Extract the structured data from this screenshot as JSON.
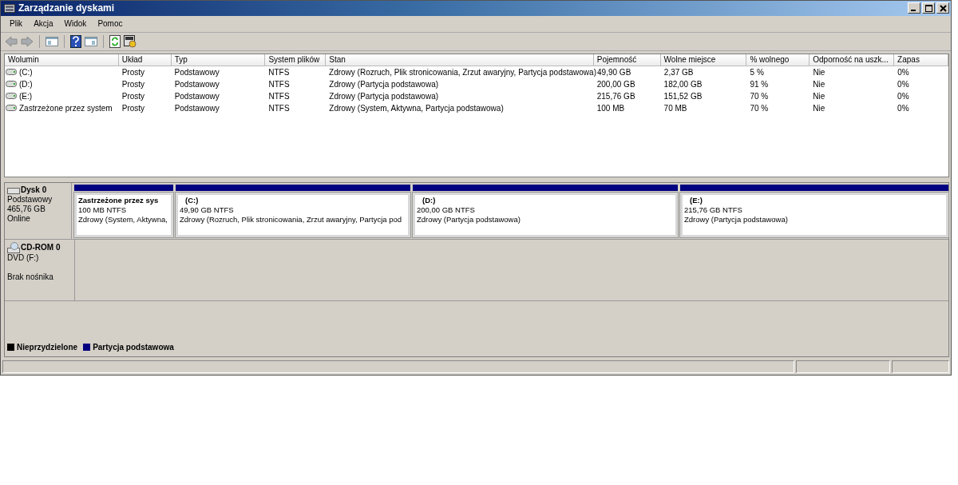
{
  "window": {
    "title": "Zarządzanie dyskami"
  },
  "menu": [
    "Plik",
    "Akcja",
    "Widok",
    "Pomoc"
  ],
  "volumes": {
    "columns": [
      "Wolumin",
      "Układ",
      "Typ",
      "System plików",
      "Stan",
      "Pojemność",
      "Wolne miejsce",
      "% wolnego",
      "Odporność na uszk...",
      "Zapas"
    ],
    "rows": [
      [
        "(C:)",
        "Prosty",
        "Podstawowy",
        "NTFS",
        "Zdrowy (Rozruch, Plik stronicowania, Zrzut awaryjny, Partycja podstawowa)",
        "49,90 GB",
        "2,37 GB",
        "5 %",
        "Nie",
        "0%"
      ],
      [
        "(D:)",
        "Prosty",
        "Podstawowy",
        "NTFS",
        "Zdrowy (Partycja podstawowa)",
        "200,00 GB",
        "182,00 GB",
        "91 %",
        "Nie",
        "0%"
      ],
      [
        "(E:)",
        "Prosty",
        "Podstawowy",
        "NTFS",
        "Zdrowy (Partycja podstawowa)",
        "215,76 GB",
        "151,52 GB",
        "70 %",
        "Nie",
        "0%"
      ],
      [
        "Zastrzeżone przez system",
        "Prosty",
        "Podstawowy",
        "NTFS",
        "Zdrowy (System, Aktywna, Partycja podstawowa)",
        "100 MB",
        "70 MB",
        "70 %",
        "Nie",
        "0%"
      ]
    ]
  },
  "disks": [
    {
      "kind": "disk",
      "name": "Dysk 0",
      "lines": [
        "Podstawowy",
        "465,76 GB",
        "Online"
      ],
      "partitions": [
        {
          "name": "Zastrzeżone przez sys",
          "size": "100 MB NTFS",
          "status": "Zdrowy (System, Aktywna,"
        },
        {
          "name": "(C:)",
          "size": "49,90 GB NTFS",
          "status": "Zdrowy (Rozruch, Plik stronicowania, Zrzut awaryjny, Partycja pod"
        },
        {
          "name": "(D:)",
          "size": "200,00 GB NTFS",
          "status": "Zdrowy (Partycja podstawowa)"
        },
        {
          "name": "(E:)",
          "size": "215,76 GB NTFS",
          "status": "Zdrowy (Partycja podstawowa)"
        }
      ]
    },
    {
      "kind": "cdrom",
      "name": "CD-ROM 0",
      "lines": [
        "DVD (F:)",
        "Brak nośnika"
      ]
    }
  ],
  "legend": [
    {
      "label": "Nieprzydzielone",
      "color": "#000000"
    },
    {
      "label": "Partycja podstawowa",
      "color": "#000080"
    }
  ]
}
